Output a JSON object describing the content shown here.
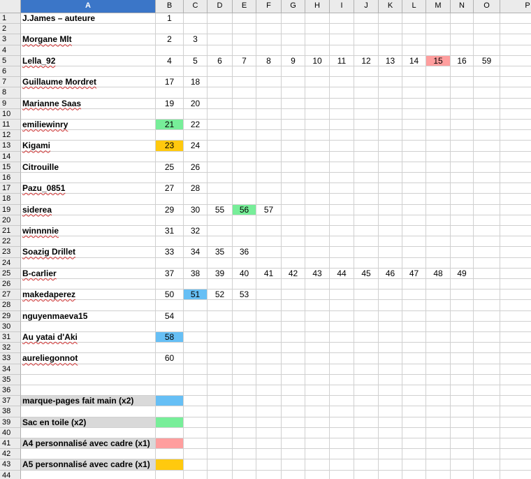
{
  "sheet": {
    "columns": [
      "A",
      "B",
      "C",
      "D",
      "E",
      "F",
      "G",
      "H",
      "I",
      "J",
      "K",
      "L",
      "M",
      "N",
      "O",
      "P"
    ],
    "selected_column": "A",
    "rows": [
      "1",
      "2",
      "3",
      "4",
      "5",
      "6",
      "7",
      "8",
      "9",
      "10",
      "11",
      "12",
      "13",
      "14",
      "15",
      "16",
      "17",
      "18",
      "19",
      "20",
      "21",
      "22",
      "23",
      "24",
      "25",
      "26",
      "27",
      "28",
      "29",
      "30",
      "31",
      "32",
      "33",
      "34",
      "35",
      "36",
      "37",
      "38",
      "39",
      "40",
      "41",
      "42",
      "43",
      "44"
    ]
  },
  "colors": {
    "blue": "#66bff5",
    "green": "#77ee99",
    "pink": "#ff9e9e",
    "yellow": "#ffc90e",
    "gray": "#d9d9d9"
  },
  "cells": [
    {
      "row": 1,
      "col": "A",
      "text": "J.James – auteure",
      "spell": false
    },
    {
      "row": 1,
      "col": "B",
      "text": "1"
    },
    {
      "row": 3,
      "col": "A",
      "text": "Morgane Mlt",
      "spell": true
    },
    {
      "row": 3,
      "col": "B",
      "text": "2"
    },
    {
      "row": 3,
      "col": "C",
      "text": "3"
    },
    {
      "row": 5,
      "col": "A",
      "text": "Lella_92",
      "spell": true
    },
    {
      "row": 5,
      "col": "B",
      "text": "4"
    },
    {
      "row": 5,
      "col": "C",
      "text": "5"
    },
    {
      "row": 5,
      "col": "D",
      "text": "6"
    },
    {
      "row": 5,
      "col": "E",
      "text": "7"
    },
    {
      "row": 5,
      "col": "F",
      "text": "8"
    },
    {
      "row": 5,
      "col": "G",
      "text": "9"
    },
    {
      "row": 5,
      "col": "H",
      "text": "10"
    },
    {
      "row": 5,
      "col": "I",
      "text": "11"
    },
    {
      "row": 5,
      "col": "J",
      "text": "12"
    },
    {
      "row": 5,
      "col": "K",
      "text": "13"
    },
    {
      "row": 5,
      "col": "L",
      "text": "14"
    },
    {
      "row": 5,
      "col": "M",
      "text": "15",
      "fill": "pink"
    },
    {
      "row": 5,
      "col": "N",
      "text": "16"
    },
    {
      "row": 5,
      "col": "O",
      "text": "59"
    },
    {
      "row": 7,
      "col": "A",
      "text": "Guillaume Mordret",
      "spell": true
    },
    {
      "row": 7,
      "col": "B",
      "text": "17"
    },
    {
      "row": 7,
      "col": "C",
      "text": "18"
    },
    {
      "row": 9,
      "col": "A",
      "text": "Marianne Saas",
      "spell": true
    },
    {
      "row": 9,
      "col": "B",
      "text": "19"
    },
    {
      "row": 9,
      "col": "C",
      "text": "20"
    },
    {
      "row": 11,
      "col": "A",
      "text": "emiliewinry",
      "spell": true
    },
    {
      "row": 11,
      "col": "B",
      "text": "21",
      "fill": "green"
    },
    {
      "row": 11,
      "col": "C",
      "text": "22"
    },
    {
      "row": 13,
      "col": "A",
      "text": "Kigami",
      "spell": true
    },
    {
      "row": 13,
      "col": "B",
      "text": "23",
      "fill": "yellow"
    },
    {
      "row": 13,
      "col": "C",
      "text": "24"
    },
    {
      "row": 15,
      "col": "A",
      "text": "Citrouille",
      "spell": false
    },
    {
      "row": 15,
      "col": "B",
      "text": "25"
    },
    {
      "row": 15,
      "col": "C",
      "text": "26"
    },
    {
      "row": 17,
      "col": "A",
      "text": "Pazu_0851",
      "spell": true
    },
    {
      "row": 17,
      "col": "B",
      "text": "27"
    },
    {
      "row": 17,
      "col": "C",
      "text": "28"
    },
    {
      "row": 19,
      "col": "A",
      "text": "siderea",
      "spell": true
    },
    {
      "row": 19,
      "col": "B",
      "text": "29"
    },
    {
      "row": 19,
      "col": "C",
      "text": "30"
    },
    {
      "row": 19,
      "col": "D",
      "text": "55"
    },
    {
      "row": 19,
      "col": "E",
      "text": "56",
      "fill": "green"
    },
    {
      "row": 19,
      "col": "F",
      "text": "57"
    },
    {
      "row": 21,
      "col": "A",
      "text": "winnnnie",
      "spell": true
    },
    {
      "row": 21,
      "col": "B",
      "text": "31"
    },
    {
      "row": 21,
      "col": "C",
      "text": "32"
    },
    {
      "row": 23,
      "col": "A",
      "text": "Soazig Drillet",
      "spell": true
    },
    {
      "row": 23,
      "col": "B",
      "text": "33"
    },
    {
      "row": 23,
      "col": "C",
      "text": "34"
    },
    {
      "row": 23,
      "col": "D",
      "text": "35"
    },
    {
      "row": 23,
      "col": "E",
      "text": "36"
    },
    {
      "row": 25,
      "col": "A",
      "text": "B-carlier",
      "spell": true
    },
    {
      "row": 25,
      "col": "B",
      "text": "37"
    },
    {
      "row": 25,
      "col": "C",
      "text": "38"
    },
    {
      "row": 25,
      "col": "D",
      "text": "39"
    },
    {
      "row": 25,
      "col": "E",
      "text": "40"
    },
    {
      "row": 25,
      "col": "F",
      "text": "41"
    },
    {
      "row": 25,
      "col": "G",
      "text": "42"
    },
    {
      "row": 25,
      "col": "H",
      "text": "43"
    },
    {
      "row": 25,
      "col": "I",
      "text": "44"
    },
    {
      "row": 25,
      "col": "J",
      "text": "45"
    },
    {
      "row": 25,
      "col": "K",
      "text": "46"
    },
    {
      "row": 25,
      "col": "L",
      "text": "47"
    },
    {
      "row": 25,
      "col": "M",
      "text": "48"
    },
    {
      "row": 25,
      "col": "N",
      "text": "49"
    },
    {
      "row": 27,
      "col": "A",
      "text": "makedaperez",
      "spell": true
    },
    {
      "row": 27,
      "col": "B",
      "text": "50"
    },
    {
      "row": 27,
      "col": "C",
      "text": "51",
      "fill": "blue"
    },
    {
      "row": 27,
      "col": "D",
      "text": "52"
    },
    {
      "row": 27,
      "col": "E",
      "text": "53"
    },
    {
      "row": 29,
      "col": "A",
      "text": "nguyenmaeva15",
      "spell": false
    },
    {
      "row": 29,
      "col": "B",
      "text": "54"
    },
    {
      "row": 31,
      "col": "A",
      "text": "Au yatai d'Aki",
      "spell": true
    },
    {
      "row": 31,
      "col": "B",
      "text": "58",
      "fill": "blue"
    },
    {
      "row": 33,
      "col": "A",
      "text": "aureliegonnot",
      "spell": true
    },
    {
      "row": 33,
      "col": "B",
      "text": "60"
    },
    {
      "row": 37,
      "col": "A",
      "text": "marque-pages fait main (x2)",
      "fill": "gray"
    },
    {
      "row": 37,
      "col": "B",
      "text": "",
      "fill": "blue"
    },
    {
      "row": 39,
      "col": "A",
      "text": "Sac en toile (x2)",
      "fill": "gray"
    },
    {
      "row": 39,
      "col": "B",
      "text": "",
      "fill": "green"
    },
    {
      "row": 41,
      "col": "A",
      "text": "A4 personnalisé avec cadre (x1)",
      "fill": "gray"
    },
    {
      "row": 41,
      "col": "B",
      "text": "",
      "fill": "pink"
    },
    {
      "row": 43,
      "col": "A",
      "text": "A5 personnalisé avec cadre (x1)",
      "fill": "gray"
    },
    {
      "row": 43,
      "col": "B",
      "text": "",
      "fill": "yellow"
    }
  ]
}
